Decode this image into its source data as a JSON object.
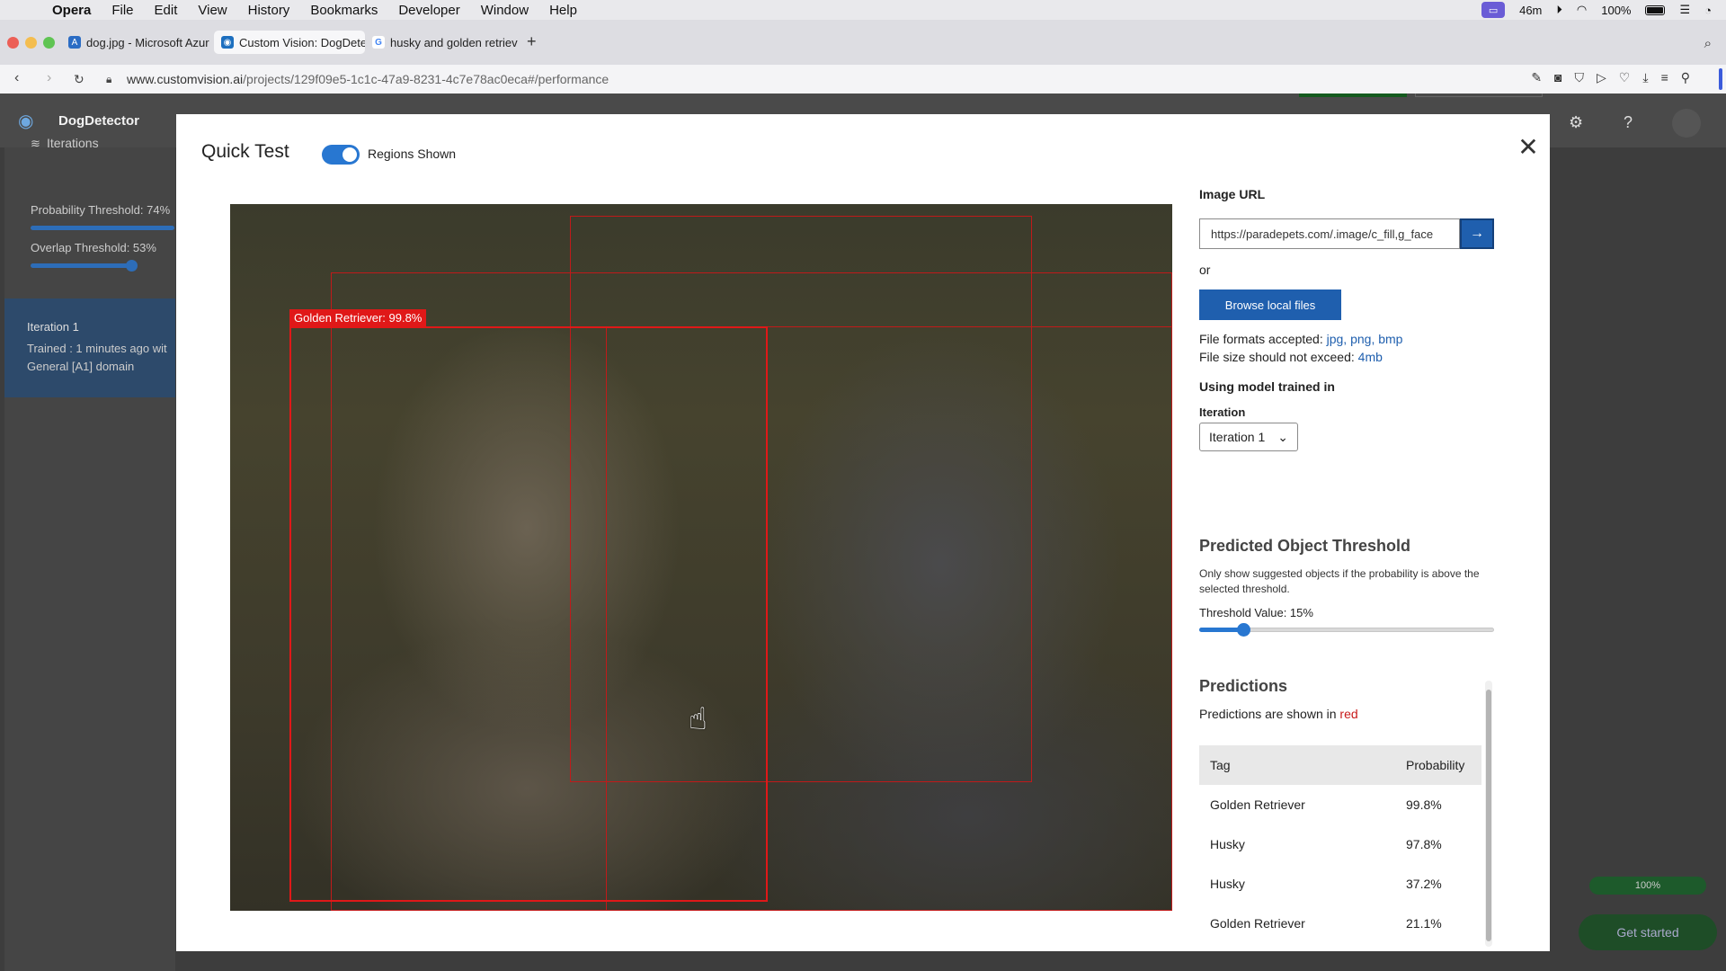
{
  "menubar": {
    "app": "Opera",
    "items": [
      "File",
      "Edit",
      "View",
      "History",
      "Bookmarks",
      "Developer",
      "Window",
      "Help"
    ],
    "time_left": "46m",
    "battery": "100%"
  },
  "tabs": [
    {
      "title": "dog.jpg - Microsoft Azur",
      "icon": "azure-icon"
    },
    {
      "title": "Custom Vision: DogDete",
      "icon": "custom-vision-icon"
    },
    {
      "title": "husky and golden retriev",
      "icon": "google-icon"
    }
  ],
  "address": {
    "host": "www.customvision.ai",
    "path": "/projects/129f09e5-1c1c-47a9-8231-4c7e78ac0eca#/performance"
  },
  "app": {
    "project_name": "DogDetector",
    "sidebar": {
      "iterations_label": "Iterations",
      "probability_threshold": "Probability Threshold: 74%",
      "overlap_threshold": "Overlap Threshold: 53%",
      "iteration_name": "Iteration 1",
      "iteration_trained": "Trained : 1 minutes ago wit",
      "iteration_domain": "General [A1] domain"
    },
    "progress": "100%",
    "get_started": "Get started"
  },
  "modal": {
    "title": "Quick Test",
    "toggle_label": "Regions Shown",
    "regions_shown": true,
    "image_url_label": "Image URL",
    "image_url_value": "https://paradepets.com/.image/c_fill,g_face",
    "or_label": "or",
    "browse_label": "Browse local files",
    "formats_prefix": "File formats accepted: ",
    "formats": "jpg, png, bmp",
    "size_prefix": "File size should not exceed: ",
    "size_value": "4mb",
    "using_model": "Using model trained in",
    "iteration_label": "Iteration",
    "iteration_selected": "Iteration 1",
    "threshold_title": "Predicted Object Threshold",
    "threshold_desc": "Only show suggested objects if the probability is above the selected threshold.",
    "threshold_value_label": "Threshold Value: 15%",
    "threshold_value": 0.15,
    "predictions_title": "Predictions",
    "predictions_sub_prefix": "Predictions are shown in ",
    "predictions_sub_color": "red",
    "table_headers": {
      "tag": "Tag",
      "probability": "Probability"
    },
    "predictions": [
      {
        "tag": "Golden Retriever",
        "probability": "99.8%"
      },
      {
        "tag": "Husky",
        "probability": "97.8%"
      },
      {
        "tag": "Husky",
        "probability": "37.2%"
      },
      {
        "tag": "Golden Retriever",
        "probability": "21.1%"
      }
    ],
    "region_label": "Golden Retriever: 99.8%"
  },
  "colors": {
    "accent": "#2877d1",
    "primary_button": "#1f5fae",
    "region": "#e01818"
  }
}
